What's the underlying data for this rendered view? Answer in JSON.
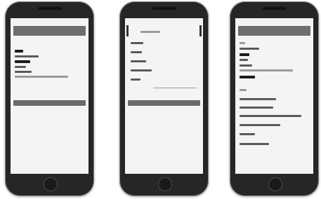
{
  "figure": {
    "panels": [
      {
        "name": "phone-1",
        "screen": "form"
      },
      {
        "name": "phone-2",
        "screen": "list"
      },
      {
        "name": "phone-3",
        "screen": "details"
      }
    ]
  }
}
